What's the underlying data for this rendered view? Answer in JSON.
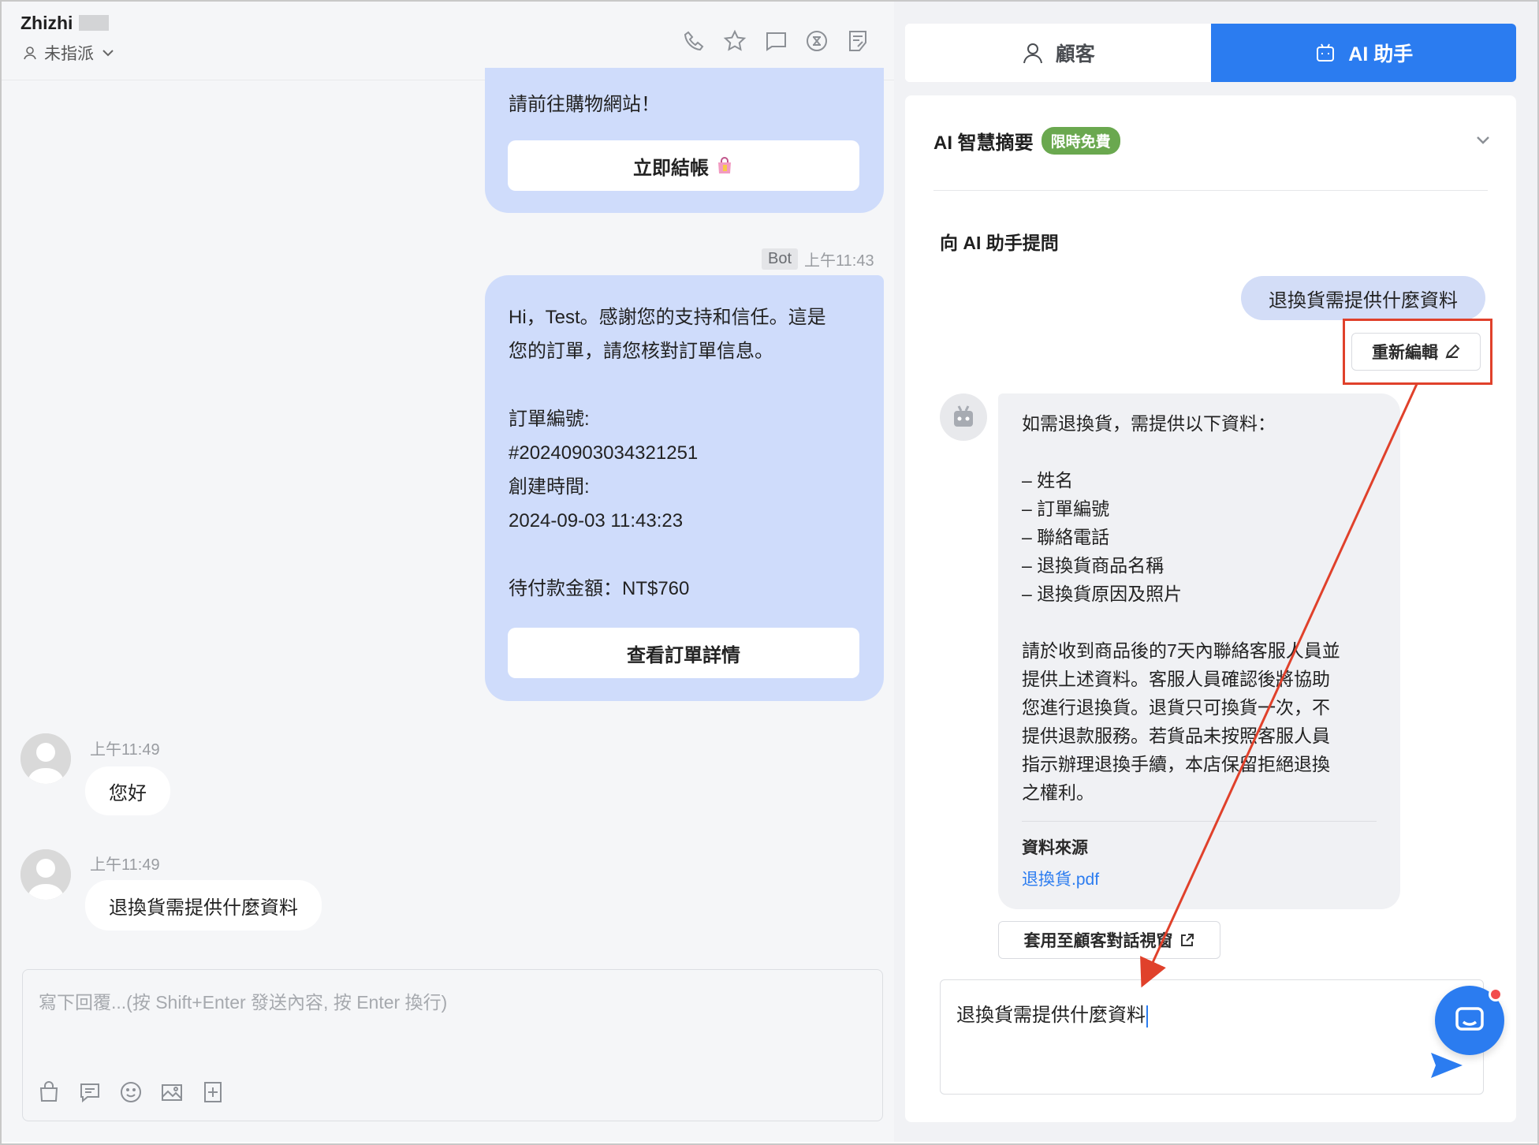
{
  "left": {
    "header": {
      "contact_name": "Zhizhi",
      "assignment": "未指派",
      "icons": [
        "phone-icon",
        "star-icon",
        "message-icon",
        "close-circle-icon",
        "note-icon"
      ]
    },
    "messages": {
      "bot1": {
        "text": "請前往購物網站！",
        "button": "立即結帳"
      },
      "bot2_meta": {
        "tag": "Bot",
        "time": "上午11:43"
      },
      "bot2": {
        "lines": [
          "Hi，Test。感謝您的支持和信任。這是",
          "您的訂單，請您核對訂單信息。",
          "",
          "訂單編號:",
          "#20240903034321251",
          "創建時間:",
          "2024-09-03 11:43:23",
          "",
          "待付款金額：NT$760"
        ],
        "button": "查看訂單詳情"
      },
      "cust1": {
        "time": "上午11:49",
        "text": "您好"
      },
      "cust2": {
        "time": "上午11:49",
        "text": "退換貨需提供什麼資料"
      }
    },
    "reply": {
      "placeholder": "寫下回覆...(按 Shift+Enter 發送內容, 按 Enter 換行)",
      "tools": [
        "bag-icon",
        "quick-reply-icon",
        "emoji-icon",
        "image-icon",
        "add-note-icon"
      ]
    }
  },
  "right": {
    "tabs": [
      {
        "label": "顧客",
        "active": false
      },
      {
        "label": "AI 助手",
        "active": true
      }
    ],
    "summary": {
      "title": "AI 智慧摘要",
      "badge": "限時免費"
    },
    "ask": {
      "title": "向 AI 助手提問",
      "user_question": "退換貨需提供什麼資料",
      "reedit_button": "重新編輯",
      "answer_lines": [
        "如需退換貨，需提供以下資料：",
        "",
        "– 姓名",
        "– 訂單編號",
        "– 聯絡電話",
        "– 退換貨商品名稱",
        "– 退換貨原因及照片",
        "",
        "請於收到商品後的7天內聯絡客服人員並",
        "提供上述資料。客服人員確認後將協助",
        "您進行退換貨。退貨只可換貨一次，不",
        "提供退款服務。若貨品未按照客服人員",
        "指示辦理退換手續，本店保留拒絕退換",
        "之權利。"
      ],
      "source_title": "資料來源",
      "source_link": "退換貨.pdf",
      "apply_button": "套用至顧客對話視窗",
      "input_value": "退換貨需提供什麼資料"
    }
  },
  "colors": {
    "accent": "#2b7cf0",
    "bot_bubble": "#cfdcfb",
    "badge_green": "#6aa84f",
    "annotation_red": "#e0412b"
  }
}
